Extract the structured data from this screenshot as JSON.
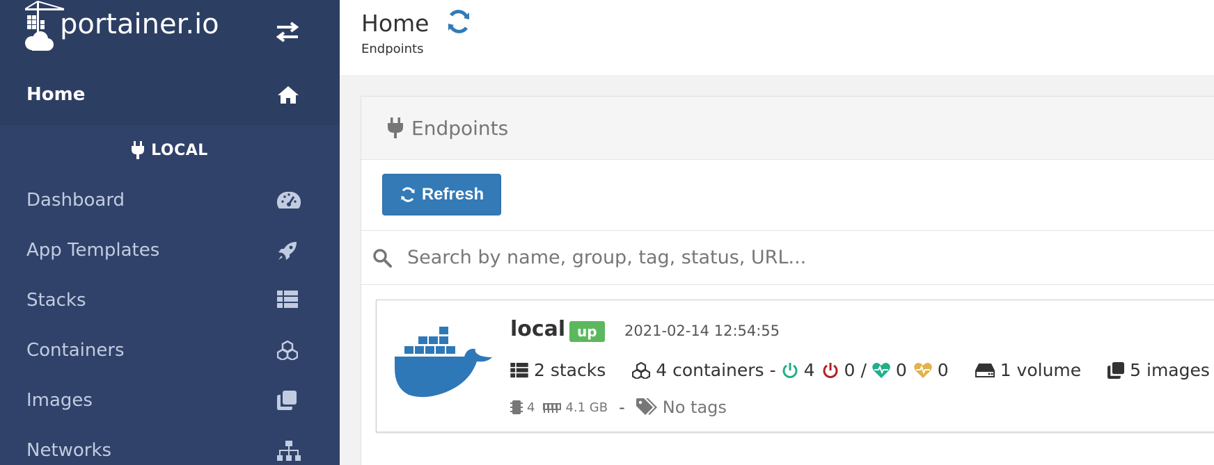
{
  "brand": {
    "name": "portainer.io"
  },
  "sidebar": {
    "home": {
      "label": "Home",
      "icon": "home-icon"
    },
    "endpoint_header": {
      "label": "LOCAL",
      "icon": "plug-icon"
    },
    "items": [
      {
        "label": "Dashboard",
        "icon": "tachometer-icon"
      },
      {
        "label": "App Templates",
        "icon": "rocket-icon"
      },
      {
        "label": "Stacks",
        "icon": "th-list-icon"
      },
      {
        "label": "Containers",
        "icon": "cubes-icon"
      },
      {
        "label": "Images",
        "icon": "clone-icon"
      },
      {
        "label": "Networks",
        "icon": "sitemap-icon"
      }
    ]
  },
  "header": {
    "title": "Home",
    "breadcrumb": "Endpoints"
  },
  "widget": {
    "title": "Endpoints",
    "refresh_label": "Refresh",
    "search_placeholder": "Search by name, group, tag, status, URL..."
  },
  "endpoint": {
    "name": "local",
    "status": "up",
    "timestamp": "2021-02-14 12:54:55",
    "stacks": "2 stacks",
    "containers": "4 containers",
    "running": "4",
    "stopped": "0",
    "healthy": "0",
    "unhealthy": "0",
    "volumes": "1 volume",
    "images": "5 images",
    "cpu": "4",
    "memory": "4.1 GB",
    "tags": "No tags"
  },
  "colors": {
    "sidebar_bg": "#30426a",
    "sidebar_dark": "#2d3e63",
    "primary": "#337ab7",
    "success": "#5cb85c",
    "running": "#23ae89",
    "stopped": "#ae2323",
    "healthy": "#23ae89",
    "unhealthy": "#e2b34a",
    "docker_blue": "#2f78b8"
  }
}
